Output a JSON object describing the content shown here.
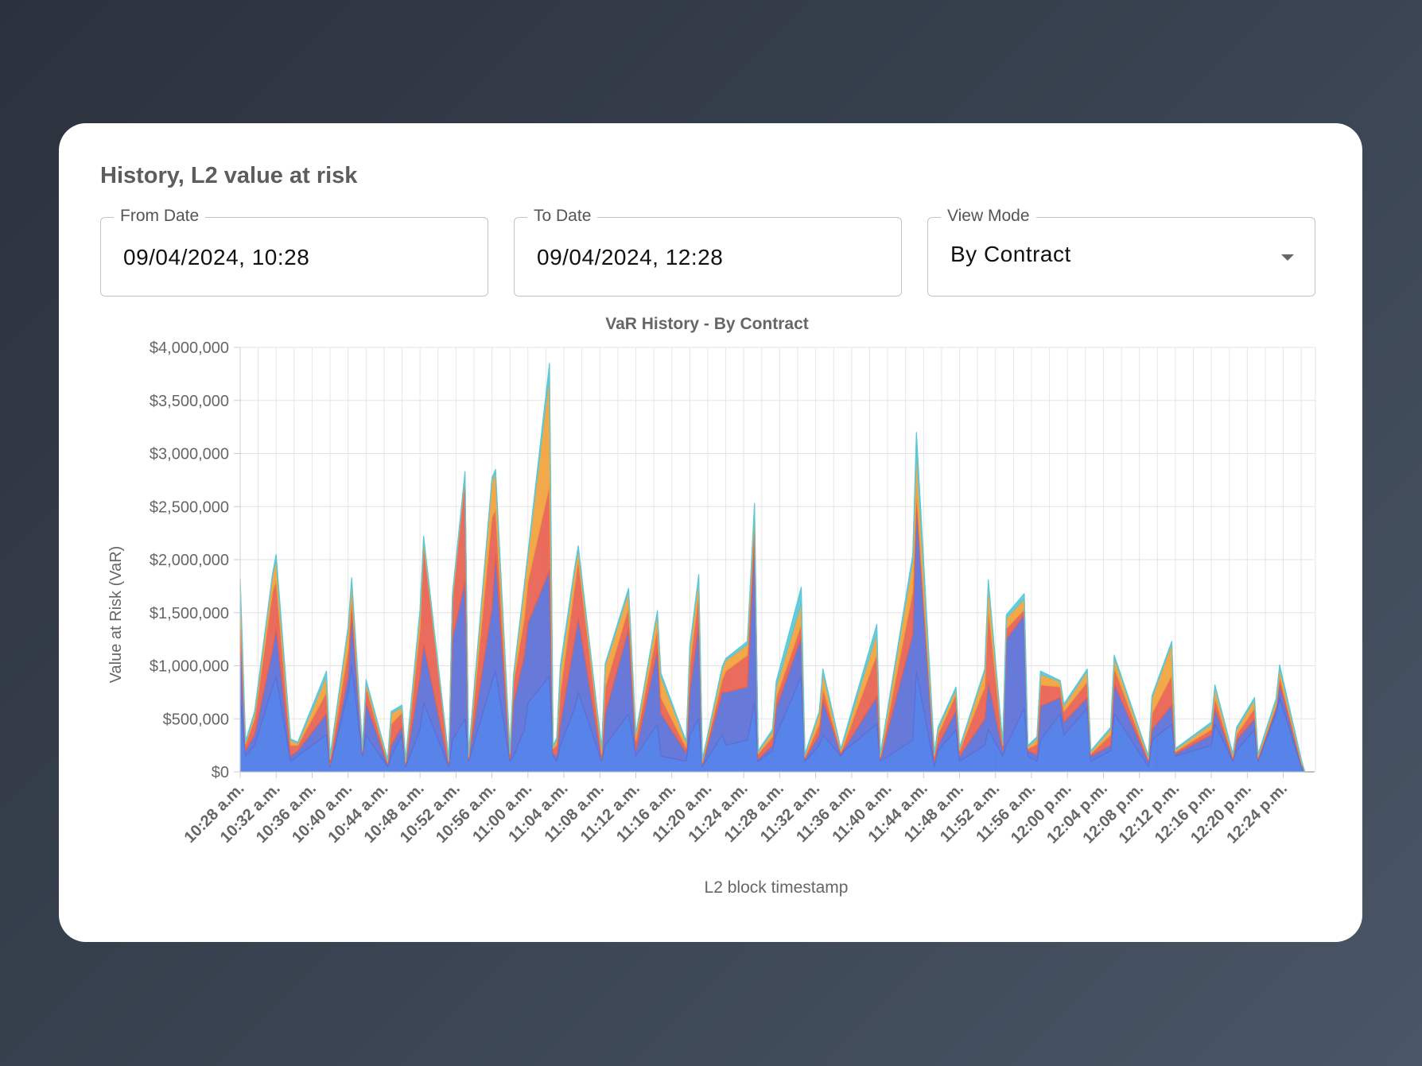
{
  "card": {
    "title": "History, L2 value at risk"
  },
  "filters": {
    "from_date": {
      "label": "From Date",
      "value": "09/04/2024, 10:28"
    },
    "to_date": {
      "label": "To Date",
      "value": "09/04/2024, 12:28"
    },
    "view_mode": {
      "label": "View Mode",
      "value": "By Contract"
    }
  },
  "chart_data": {
    "type": "area",
    "stacked": true,
    "title": "VaR History - By Contract",
    "xlabel": "L2 block timestamp",
    "ylabel": "Value at Risk (VaR)",
    "ylim": [
      0,
      4000000
    ],
    "yticks": [
      "$0",
      "$500,000",
      "$1,000,000",
      "$1,500,000",
      "$2,000,000",
      "$2,500,000",
      "$3,000,000",
      "$3,500,000",
      "$4,000,000"
    ],
    "xticks": [
      "10:28 a.m.",
      "10:32 a.m.",
      "10:36 a.m.",
      "10:40 a.m.",
      "10:44 a.m.",
      "10:48 a.m.",
      "10:52 a.m.",
      "10:56 a.m.",
      "11:00 a.m.",
      "11:04 a.m.",
      "11:08 a.m.",
      "11:12 a.m.",
      "11:16 a.m.",
      "11:20 a.m.",
      "11:24 a.m.",
      "11:28 a.m.",
      "11:32 a.m.",
      "11:36 a.m.",
      "11:40 a.m.",
      "11:44 a.m.",
      "11:48 a.m.",
      "11:52 a.m.",
      "11:56 a.m.",
      "12:00 p.m.",
      "12:04 p.m.",
      "12:08 p.m.",
      "12:12 p.m.",
      "12:16 p.m.",
      "12:20 p.m.",
      "12:24 p.m."
    ],
    "grid": true,
    "x_minutes_from_1028": [
      0,
      0.6,
      1.6,
      3.6,
      4,
      5.6,
      6.4,
      9.6,
      10,
      12,
      12.4,
      13.6,
      14,
      16.4,
      16.8,
      18,
      18.4,
      20,
      20.4,
      23.2,
      23.6,
      25,
      25.4,
      28,
      28.4,
      30,
      30.4,
      31.6,
      32,
      34.4,
      34.8,
      35.2,
      35.6,
      37.2,
      37.6,
      40.2,
      40.6,
      43.2,
      44,
      46.4,
      46.8,
      49.6,
      50,
      51,
      51.4,
      53.6,
      54,
      56.4,
      57.2,
      57.6,
      59.2,
      59.6,
      62.4,
      62.8,
      64.4,
      64.8,
      66.8,
      67.2,
      70.8,
      71.2,
      74.8,
      75.2,
      77.2,
      77.6,
      79.6,
      80,
      82.8,
      83.2,
      84.8,
      85.2,
      87.2,
      87.6,
      88.6,
      89,
      91.2,
      91.6,
      94.2,
      94.6,
      96.8,
      97.2,
      101,
      101.4,
      103.6,
      104,
      108,
      108.4,
      110.4,
      110.8,
      112.8,
      113.2,
      115.2,
      115.6,
      118,
      118.4,
      119.4
    ],
    "series": [
      {
        "color": "#4a78e6",
        "values": [
          700000,
          150000,
          250000,
          800000,
          900000,
          100000,
          150000,
          350000,
          50000,
          750000,
          1000000,
          150000,
          350000,
          50000,
          150000,
          350000,
          50000,
          400000,
          650000,
          50000,
          300000,
          500000,
          100000,
          850000,
          950000,
          100000,
          150000,
          400000,
          650000,
          900000,
          150000,
          100000,
          250000,
          600000,
          750000,
          100000,
          250000,
          550000,
          150000,
          450000,
          150000,
          100000,
          350000,
          500000,
          50000,
          350000,
          250000,
          300000,
          650000,
          100000,
          200000,
          350000,
          900000,
          100000,
          250000,
          350000,
          150000,
          200000,
          450000,
          100000,
          300000,
          950000,
          50000,
          200000,
          400000,
          100000,
          250000,
          400000,
          150000,
          250000,
          600000,
          150000,
          100000,
          300000,
          550000,
          350000,
          600000,
          100000,
          200000,
          550000,
          50000,
          300000,
          450000,
          150000,
          250000,
          450000,
          100000,
          200000,
          400000,
          100000,
          550000,
          700000,
          50000
        ]
      },
      {
        "color": "#5b6fd6",
        "values": [
          650000,
          50000,
          100000,
          350000,
          450000,
          50000,
          50000,
          200000,
          20000,
          150000,
          500000,
          30000,
          300000,
          20000,
          100000,
          80000,
          20000,
          500000,
          550000,
          20000,
          950000,
          1300000,
          20000,
          700000,
          1100000,
          20000,
          500000,
          700000,
          750000,
          1000000,
          20000,
          50000,
          200000,
          650000,
          700000,
          20000,
          300000,
          800000,
          50000,
          700000,
          400000,
          80000,
          400000,
          900000,
          20000,
          400000,
          500000,
          500000,
          1550000,
          20000,
          50000,
          250000,
          370000,
          20000,
          100000,
          330000,
          20000,
          20000,
          260000,
          20000,
          1000000,
          1580000,
          50000,
          50000,
          180000,
          50000,
          250000,
          450000,
          50000,
          1000000,
          880000,
          50000,
          60000,
          320000,
          150000,
          120000,
          100000,
          50000,
          50000,
          280000,
          50000,
          100000,
          180000,
          20000,
          100000,
          150000,
          20000,
          100000,
          100000,
          20000,
          50000,
          130000,
          20000
        ]
      },
      {
        "color": "#e8604f",
        "values": [
          220000,
          60000,
          150000,
          550000,
          450000,
          100000,
          50000,
          200000,
          50000,
          250000,
          150000,
          20000,
          150000,
          20000,
          200000,
          130000,
          20000,
          450000,
          950000,
          30000,
          350000,
          980000,
          20000,
          850000,
          420000,
          50000,
          200000,
          350000,
          390000,
          800000,
          50000,
          100000,
          300000,
          500000,
          550000,
          50000,
          250000,
          200000,
          100000,
          200000,
          150000,
          50000,
          250000,
          280000,
          20000,
          120000,
          200000,
          300000,
          200000,
          50000,
          80000,
          100000,
          120000,
          20000,
          100000,
          110000,
          20000,
          50000,
          400000,
          20000,
          400000,
          120000,
          50000,
          100000,
          150000,
          50000,
          300000,
          700000,
          50000,
          100000,
          50000,
          20000,
          100000,
          200000,
          100000,
          100000,
          150000,
          20000,
          100000,
          150000,
          20000,
          150000,
          280000,
          20000,
          50000,
          100000,
          20000,
          50000,
          100000,
          20000,
          20000,
          70000,
          20000
        ]
      },
      {
        "color": "#f0a23a",
        "values": [
          230000,
          20000,
          50000,
          150000,
          200000,
          50000,
          20000,
          150000,
          20000,
          200000,
          150000,
          20000,
          50000,
          20000,
          100000,
          50000,
          20000,
          150000,
          50000,
          20000,
          50000,
          30000,
          20000,
          350000,
          350000,
          20000,
          50000,
          300000,
          250000,
          1050000,
          20000,
          50000,
          200000,
          150000,
          100000,
          50000,
          200000,
          150000,
          50000,
          150000,
          200000,
          50000,
          150000,
          150000,
          20000,
          100000,
          100000,
          100000,
          100000,
          20000,
          50000,
          100000,
          200000,
          20000,
          100000,
          150000,
          20000,
          50000,
          200000,
          20000,
          300000,
          400000,
          20000,
          50000,
          50000,
          20000,
          150000,
          230000,
          20000,
          100000,
          100000,
          20000,
          50000,
          100000,
          50000,
          50000,
          100000,
          20000,
          50000,
          100000,
          20000,
          150000,
          300000,
          20000,
          50000,
          100000,
          20000,
          50000,
          80000,
          20000,
          50000,
          80000,
          20000
        ]
      },
      {
        "color": "#5ac8d8",
        "values": [
          20000,
          10000,
          20000,
          20000,
          50000,
          10000,
          10000,
          50000,
          10000,
          20000,
          30000,
          10000,
          20000,
          10000,
          20000,
          20000,
          10000,
          30000,
          20000,
          10000,
          20000,
          20000,
          10000,
          20000,
          30000,
          10000,
          20000,
          20000,
          20000,
          100000,
          10000,
          20000,
          50000,
          30000,
          30000,
          10000,
          20000,
          30000,
          10000,
          20000,
          30000,
          10000,
          30000,
          30000,
          10000,
          20000,
          20000,
          30000,
          30000,
          10000,
          20000,
          50000,
          150000,
          10000,
          20000,
          30000,
          10000,
          20000,
          80000,
          10000,
          50000,
          150000,
          10000,
          20000,
          20000,
          10000,
          20000,
          30000,
          10000,
          30000,
          50000,
          10000,
          20000,
          30000,
          10000,
          20000,
          20000,
          10000,
          20000,
          20000,
          10000,
          20000,
          20000,
          10000,
          20000,
          20000,
          10000,
          20000,
          20000,
          10000,
          20000,
          30000,
          10000
        ]
      }
    ]
  }
}
